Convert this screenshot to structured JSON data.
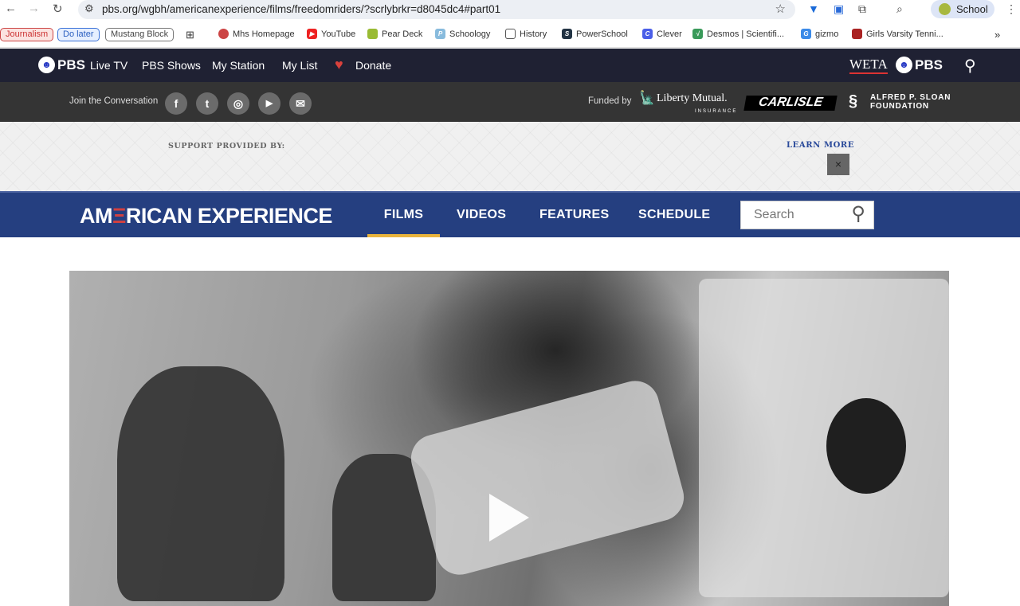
{
  "browser": {
    "url": "pbs.org/wgbh/americanexperience/films/freedomriders/?scrlybrkr=d8045dc4#part01",
    "profile": "School",
    "bookmarks": {
      "chips": [
        "Journalism",
        "Do later",
        "Mustang Block"
      ],
      "items": [
        "Mhs Homepage",
        "YouTube",
        "Pear Deck",
        "Schoology",
        "History",
        "PowerSchool",
        "Clever",
        "Desmos | Scientifi...",
        "gizmo",
        "Girls Varsity Tenni..."
      ],
      "more": "»"
    }
  },
  "pbs_nav": {
    "logo": "PBS",
    "items": [
      "Live TV",
      "PBS Shows",
      "My Station",
      "My List",
      "Donate"
    ],
    "station_logo": "WETA",
    "station_pbs": "PBS"
  },
  "social": {
    "label": "Join the Conversation",
    "icons": [
      "f",
      "t",
      "◎",
      "▶",
      "✉"
    ]
  },
  "funders": {
    "label": "Funded by",
    "liberty": "Liberty Mutual.",
    "liberty_sub": "INSURANCE",
    "carlisle": "CARLISLE",
    "sloan": "ALFRED P. SLOAN",
    "sloan_sub": "FOUNDATION"
  },
  "ad": {
    "support": "SUPPORT PROVIDED BY:",
    "learn_more": "LEARN MORE",
    "close": "×"
  },
  "ae_nav": {
    "logo_a": "AM",
    "logo_e": "Ξ",
    "logo_b": "RICAN EXPERIENCE",
    "tabs": [
      "FILMS",
      "VIDEOS",
      "FEATURES",
      "SCHEDULE"
    ],
    "search_placeholder": "Search"
  },
  "colors": {
    "pbs_nav": "#1f2133",
    "ae_nav": "#253f80",
    "active_tab": "#eab43c"
  }
}
